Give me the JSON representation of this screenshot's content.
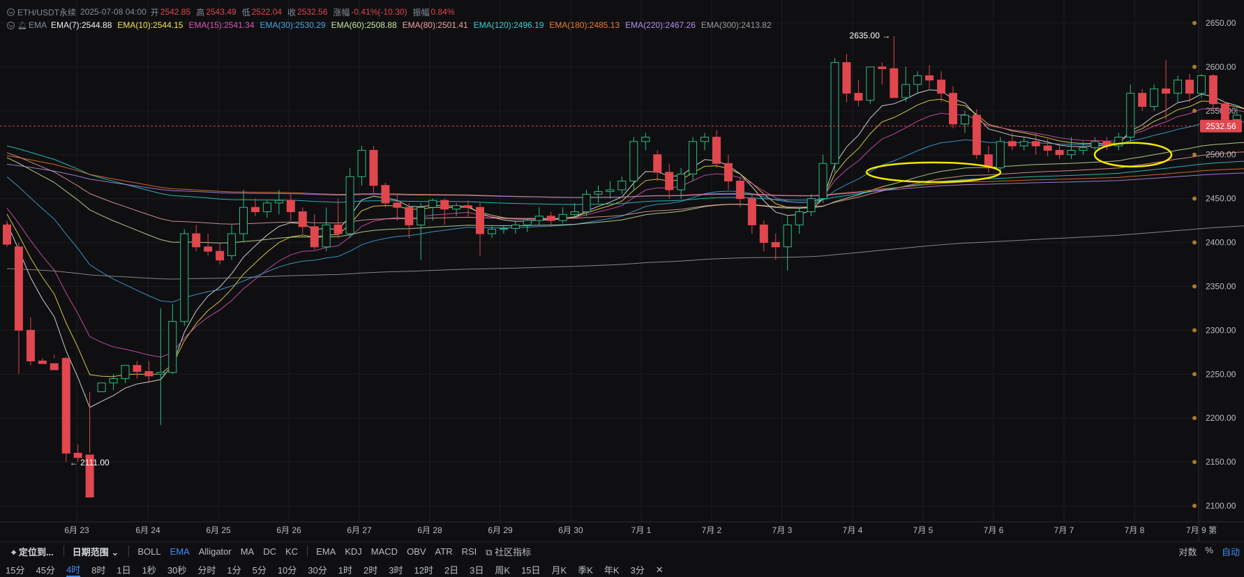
{
  "legend": {
    "symbol": "ETH/USDT永续",
    "datetime": "2025-07-08 04:00",
    "open_label": "开",
    "open": "2542.85",
    "high_label": "高",
    "high": "2543.49",
    "low_label": "低",
    "low": "2522.04",
    "close_label": "收",
    "close": "2532.56",
    "change_label": "涨幅",
    "change": "-0.41%(-10.30)",
    "amp_label": "振幅",
    "amp": "0.84%",
    "ema_label": "EMA",
    "emas": [
      {
        "text": "EMA(7):2544.88",
        "color": "#f0f0f0"
      },
      {
        "text": "EMA(10):2544.15",
        "color": "#f5e44a"
      },
      {
        "text": "EMA(15):2541.34",
        "color": "#e052b8"
      },
      {
        "text": "EMA(30):2530.29",
        "color": "#3fa9e8"
      },
      {
        "text": "EMA(60):2508.88",
        "color": "#c8e6a0"
      },
      {
        "text": "EMA(80):2501.41",
        "color": "#f0a0a0"
      },
      {
        "text": "EMA(120):2496.19",
        "color": "#2ad4d4"
      },
      {
        "text": "EMA(180):2485.13",
        "color": "#f07a2a"
      },
      {
        "text": "EMA(220):2467.26",
        "color": "#b58cf0"
      },
      {
        "text": "EMA(300):2413.82",
        "color": "#9a9a9a"
      }
    ]
  },
  "price_tag": "2532.56",
  "annotations": {
    "high_label": "2635.00 →",
    "low_label": "← 2111.00"
  },
  "bottom_toolbar": {
    "locate": "定位到...",
    "date_range": "日期范围",
    "main_indicators": [
      "BOLL",
      "EMA",
      "Alligator",
      "MA",
      "DC",
      "KC"
    ],
    "active_main": "EMA",
    "sub_indicators": [
      "EMA",
      "KDJ",
      "MACD",
      "OBV",
      "ATR",
      "RSI"
    ],
    "community": "社区指标",
    "right": [
      "对数",
      "%",
      "自动"
    ]
  },
  "timeframes": [
    "15分",
    "45分",
    "4时",
    "8时",
    "1日",
    "1秒",
    "30秒",
    "分时",
    "1分",
    "5分",
    "10分",
    "30分",
    "1时",
    "2时",
    "3时",
    "12时",
    "2日",
    "3日",
    "周K",
    "15日",
    "月K",
    "季K",
    "年K",
    "3分"
  ],
  "active_timeframe": "4时",
  "colors": {
    "up": "#2ebd85",
    "down": "#e0474f",
    "bg": "#0f0f11",
    "grid": "#1c1e22",
    "highlight": "#f5e600"
  },
  "chart_data": {
    "type": "candlestick",
    "x_tick_labels": [
      "6月 23",
      "6月 24",
      "6月 25",
      "6月 26",
      "6月 27",
      "6月 28",
      "6月 29",
      "6月 30",
      "7月 1",
      "7月 2",
      "7月 3",
      "7月 4",
      "7月 5",
      "7月 6",
      "7月 7",
      "7月 8",
      "7月 9 第"
    ],
    "y_tick_labels": [
      "2100.00",
      "2150.00",
      "2200.00",
      "2250.00",
      "2300.00",
      "2350.00",
      "2400.00",
      "2450.00",
      "2500.00",
      "2550.00",
      "2600.00",
      "2650.00"
    ],
    "ylim": [
      2085,
      2665
    ],
    "candles": [
      [
        2420,
        2425,
        2398,
        2395
      ],
      [
        2395,
        2400,
        2300,
        2250
      ],
      [
        2300,
        2315,
        2265,
        2260
      ],
      [
        2265,
        2268,
        2262,
        2262
      ],
      [
        2262,
        2272,
        2255,
        2268
      ],
      [
        2268,
        2270,
        2160,
        2150
      ],
      [
        2160,
        2170,
        2155,
        2150
      ],
      [
        2158,
        2230,
        2110,
        2160
      ],
      [
        2230,
        2232,
        2240,
        2230
      ],
      [
        2240,
        2250,
        2245,
        2232
      ],
      [
        2245,
        2260,
        2260,
        2240
      ],
      [
        2260,
        2265,
        2253,
        2245
      ],
      [
        2253,
        2265,
        2248,
        2240
      ],
      [
        2250,
        2325,
        2252,
        2192
      ],
      [
        2252,
        2330,
        2310,
        2250
      ],
      [
        2310,
        2415,
        2410,
        2305
      ],
      [
        2410,
        2420,
        2395,
        2390
      ],
      [
        2395,
        2410,
        2390,
        2385
      ],
      [
        2390,
        2400,
        2380,
        2375
      ],
      [
        2385,
        2420,
        2410,
        2380
      ],
      [
        2410,
        2460,
        2440,
        2400
      ],
      [
        2440,
        2450,
        2435,
        2430
      ],
      [
        2435,
        2448,
        2445,
        2428
      ],
      [
        2445,
        2460,
        2448,
        2432
      ],
      [
        2448,
        2455,
        2435,
        2425
      ],
      [
        2435,
        2440,
        2418,
        2410
      ],
      [
        2418,
        2432,
        2395,
        2392
      ],
      [
        2395,
        2440,
        2420,
        2390
      ],
      [
        2420,
        2450,
        2410,
        2405
      ],
      [
        2410,
        2485,
        2475,
        2405
      ],
      [
        2475,
        2510,
        2505,
        2465
      ],
      [
        2505,
        2510,
        2465,
        2455
      ],
      [
        2465,
        2468,
        2445,
        2440
      ],
      [
        2445,
        2455,
        2440,
        2425
      ],
      [
        2440,
        2445,
        2420,
        2405
      ],
      [
        2420,
        2445,
        2440,
        2380
      ],
      [
        2440,
        2450,
        2448,
        2425
      ],
      [
        2448,
        2450,
        2438,
        2420
      ],
      [
        2438,
        2445,
        2442,
        2430
      ],
      [
        2442,
        2448,
        2440,
        2430
      ],
      [
        2440,
        2445,
        2410,
        2385
      ],
      [
        2410,
        2420,
        2415,
        2405
      ],
      [
        2415,
        2420,
        2416,
        2410
      ],
      [
        2416,
        2425,
        2420,
        2410
      ],
      [
        2420,
        2428,
        2425,
        2412
      ],
      [
        2425,
        2440,
        2430,
        2420
      ],
      [
        2430,
        2435,
        2425,
        2418
      ],
      [
        2425,
        2440,
        2432,
        2422
      ],
      [
        2432,
        2445,
        2435,
        2428
      ],
      [
        2435,
        2460,
        2455,
        2430
      ],
      [
        2455,
        2465,
        2458,
        2445
      ],
      [
        2458,
        2470,
        2460,
        2450
      ],
      [
        2460,
        2475,
        2470,
        2455
      ],
      [
        2470,
        2520,
        2515,
        2460
      ],
      [
        2515,
        2525,
        2520,
        2505
      ],
      [
        2500,
        2505,
        2480,
        2470
      ],
      [
        2480,
        2490,
        2460,
        2450
      ],
      [
        2460,
        2485,
        2478,
        2450
      ],
      [
        2478,
        2520,
        2515,
        2470
      ],
      [
        2515,
        2525,
        2520,
        2505
      ],
      [
        2520,
        2528,
        2490,
        2485
      ],
      [
        2490,
        2500,
        2470,
        2460
      ],
      [
        2470,
        2475,
        2450,
        2440
      ],
      [
        2450,
        2455,
        2420,
        2410
      ],
      [
        2420,
        2425,
        2400,
        2390
      ],
      [
        2400,
        2410,
        2395,
        2380
      ],
      [
        2395,
        2430,
        2420,
        2368
      ],
      [
        2420,
        2440,
        2435,
        2410
      ],
      [
        2435,
        2455,
        2450,
        2430
      ],
      [
        2450,
        2500,
        2490,
        2445
      ],
      [
        2490,
        2610,
        2605,
        2480
      ],
      [
        2605,
        2615,
        2570,
        2560
      ],
      [
        2570,
        2585,
        2562,
        2555
      ],
      [
        2562,
        2600,
        2600,
        2558
      ],
      [
        2600,
        2605,
        2598,
        2580
      ],
      [
        2598,
        2635,
        2565,
        2565
      ],
      [
        2565,
        2600,
        2580,
        2560
      ],
      [
        2580,
        2595,
        2590,
        2570
      ],
      [
        2590,
        2602,
        2585,
        2575
      ],
      [
        2585,
        2595,
        2570,
        2560
      ],
      [
        2570,
        2578,
        2535,
        2530
      ],
      [
        2535,
        2550,
        2545,
        2525
      ],
      [
        2545,
        2552,
        2500,
        2495
      ],
      [
        2500,
        2510,
        2485,
        2480
      ],
      [
        2485,
        2520,
        2515,
        2480
      ],
      [
        2515,
        2525,
        2510,
        2505
      ],
      [
        2510,
        2520,
        2515,
        2505
      ],
      [
        2515,
        2525,
        2510,
        2500
      ],
      [
        2510,
        2518,
        2505,
        2498
      ],
      [
        2505,
        2512,
        2500,
        2495
      ],
      [
        2500,
        2520,
        2505,
        2495
      ],
      [
        2505,
        2515,
        2508,
        2500
      ],
      [
        2508,
        2520,
        2515,
        2505
      ],
      [
        2515,
        2520,
        2510,
        2505
      ],
      [
        2510,
        2525,
        2520,
        2505
      ],
      [
        2520,
        2580,
        2570,
        2515
      ],
      [
        2570,
        2575,
        2555,
        2550
      ],
      [
        2555,
        2580,
        2575,
        2550
      ],
      [
        2575,
        2608,
        2570,
        2540
      ],
      [
        2570,
        2590,
        2585,
        2560
      ],
      [
        2585,
        2592,
        2570,
        2560
      ],
      [
        2570,
        2592,
        2590,
        2565
      ],
      [
        2590,
        2592,
        2558,
        2550
      ],
      [
        2558,
        2560,
        2540,
        2535
      ],
      [
        2540,
        2555,
        2545,
        2535
      ],
      [
        2542.85,
        2543.49,
        2532.56,
        2522.04
      ]
    ]
  }
}
